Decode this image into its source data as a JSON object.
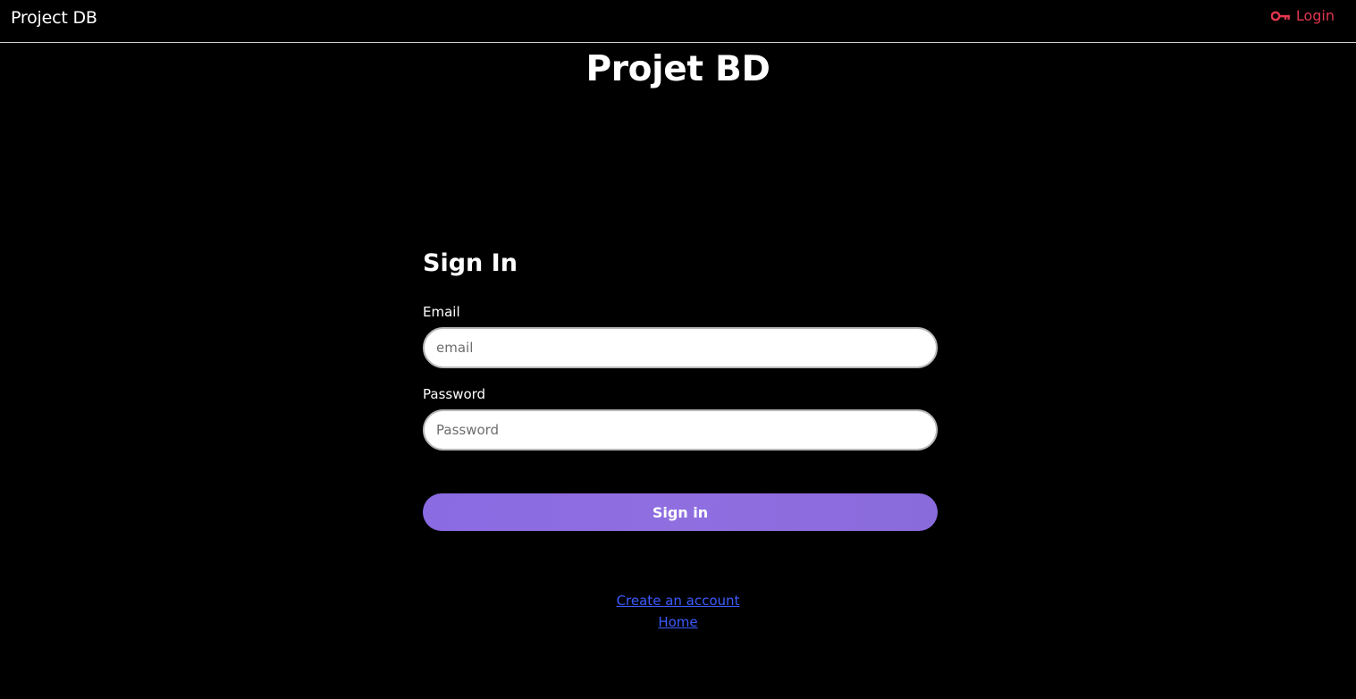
{
  "navbar": {
    "brand": "Project DB",
    "login_label": "Login",
    "login_icon": "key-icon",
    "login_color": "#e0364f"
  },
  "page": {
    "title": "Projet BD"
  },
  "form": {
    "heading": "Sign In",
    "email_label": "Email",
    "email_placeholder": "email",
    "email_value": "",
    "password_label": "Password",
    "password_placeholder": "Password",
    "password_value": "",
    "submit_label": "Sign in",
    "submit_color": "#8a6be2"
  },
  "links": {
    "create_account": "Create an account",
    "home": "Home",
    "color": "#3b5bff"
  }
}
